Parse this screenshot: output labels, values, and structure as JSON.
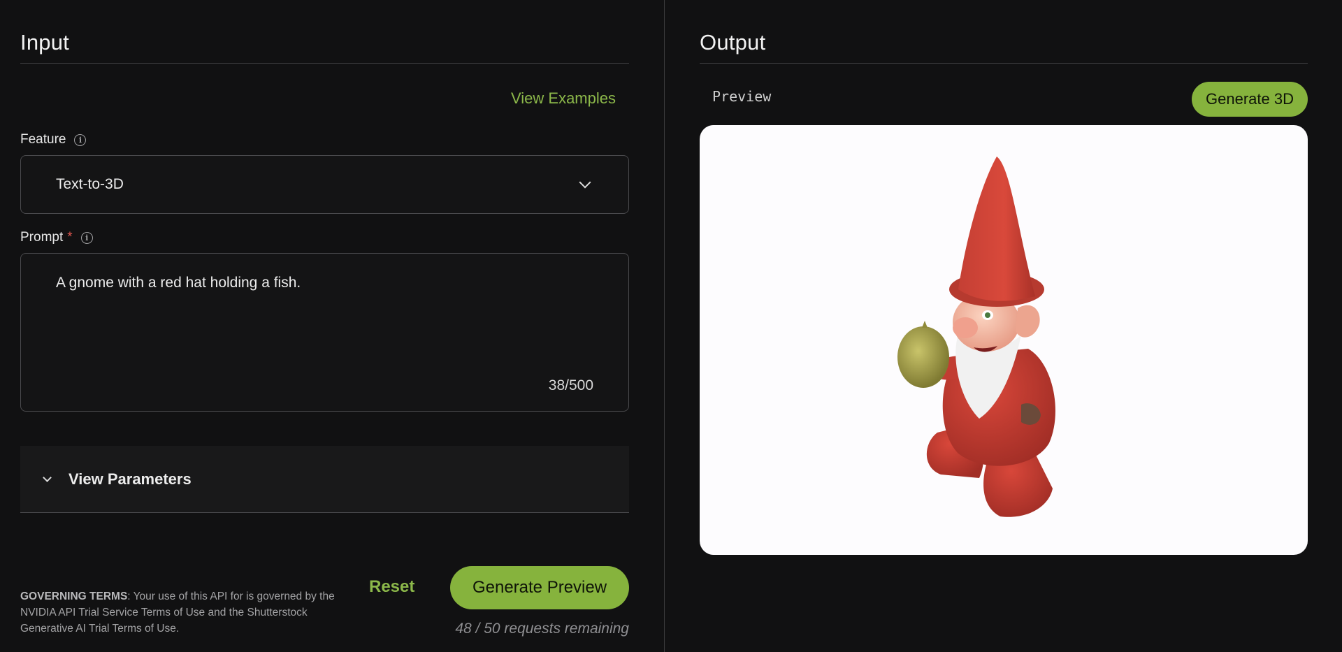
{
  "input_panel": {
    "title": "Input",
    "view_examples_label": "View Examples",
    "feature": {
      "label": "Feature",
      "selected_value": "Text-to-3D"
    },
    "prompt": {
      "label": "Prompt",
      "required_mark": "*",
      "value": "A gnome with a red hat holding a fish.",
      "char_count": "38/500"
    },
    "parameters": {
      "label": "View Parameters"
    },
    "terms": {
      "heading": "GOVERNING TERMS",
      "text": ": Your use of this API for is governed by the NVIDIA API Trial Service Terms of Use and the Shutterstock Generative AI Trial Terms of Use."
    },
    "reset_label": "Reset",
    "generate_preview_label": "Generate Preview",
    "requests_remaining": "48 / 50 requests remaining"
  },
  "output_panel": {
    "title": "Output",
    "preview_label": "Preview",
    "generate_3d_label": "Generate 3D",
    "preview_subject_icon": "gnome-3d-model"
  },
  "colors": {
    "background": "#111112",
    "accent": "#86b33d",
    "accent_text": "#8cb84a",
    "required": "#e0564f",
    "preview_bg": "#fdfcfe"
  }
}
